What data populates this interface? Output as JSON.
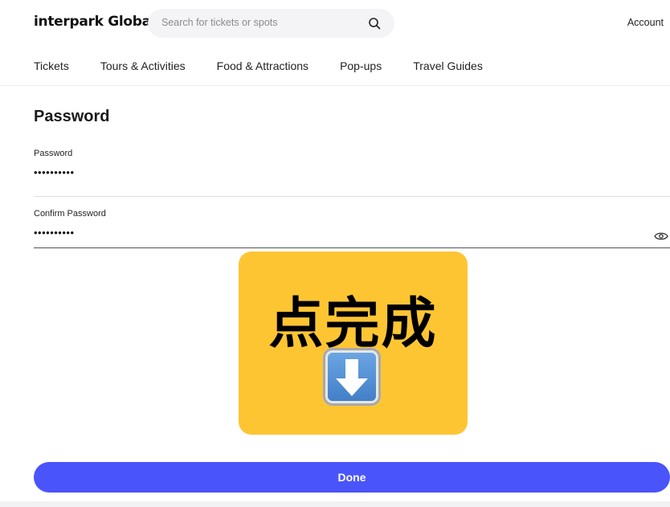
{
  "header": {
    "logo": "interpark Global",
    "search_placeholder": "Search for tickets or spots",
    "account_label": "Account"
  },
  "nav": {
    "items": [
      "Tickets",
      "Tours & Activities",
      "Food & Attractions",
      "Pop-ups",
      "Travel Guides"
    ]
  },
  "form": {
    "title": "Password",
    "password": {
      "label": "Password",
      "value": "••••••••••"
    },
    "confirm": {
      "label": "Confirm Password",
      "value": "••••••••••"
    }
  },
  "overlay": {
    "text": "点完成",
    "icon": "down-arrow-emoji",
    "background": "#fec533"
  },
  "actions": {
    "done_label": "Done"
  },
  "colors": {
    "accent": "#4a54fb"
  }
}
